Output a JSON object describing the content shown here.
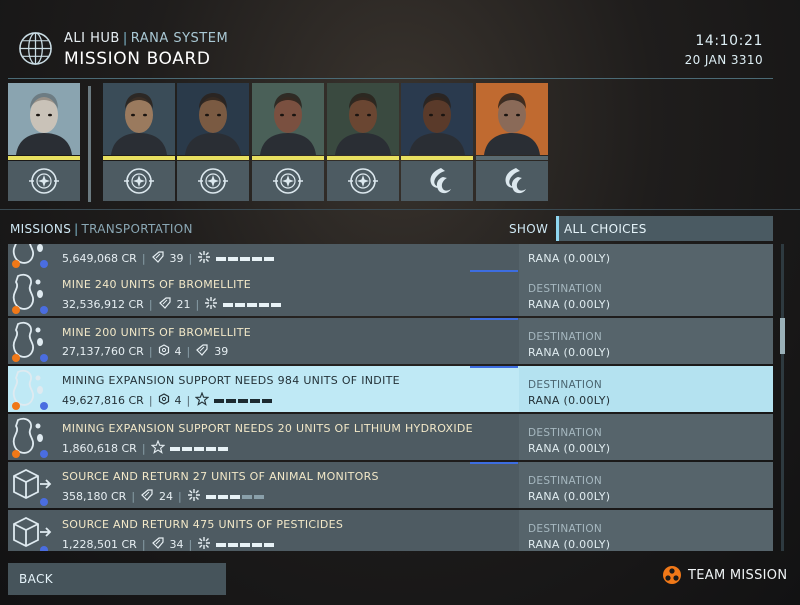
{
  "header": {
    "station": "ALI HUB",
    "system": "RANA SYSTEM",
    "title": "MISSION BOARD",
    "time": "14:10:21",
    "date": "20 JAN 3310"
  },
  "portraits": [
    {
      "faction_icon": "federation-emblem-icon",
      "bar_color": "#e8e060"
    },
    {
      "faction_icon": "federation-emblem-icon",
      "bar_color": "#e8e060"
    },
    {
      "faction_icon": "federation-emblem-icon",
      "bar_color": "#e8e060"
    },
    {
      "faction_icon": "federation-emblem-icon",
      "bar_color": "#e8e060"
    },
    {
      "faction_icon": "federation-emblem-icon",
      "bar_color": "#e8e060"
    },
    {
      "faction_icon": "alliance-emblem-icon",
      "bar_color": "#e8e060"
    },
    {
      "faction_icon": "alliance-emblem-icon",
      "bar_color": "#5a6a70"
    }
  ],
  "missions_header": {
    "label": "MISSIONS",
    "category": "TRANSPORTATION",
    "show_label": "SHOW",
    "filter_value": "ALL CHOICES"
  },
  "missions": [
    {
      "title": "",
      "reward": "5,649,068 CR",
      "rep": "39",
      "dest_label": "",
      "dest": "RANA (0.00LY)",
      "icon": "mining-icon",
      "accent": false
    },
    {
      "title": "MINE 240 UNITS OF BROMELLITE",
      "reward": "32,536,912 CR",
      "rep": "21",
      "dest_label": "DESTINATION",
      "dest": "RANA (0.00LY)",
      "icon": "mining-icon",
      "accent": true
    },
    {
      "title": "MINE 200 UNITS OF BROMELLITE",
      "reward": "27,137,760 CR",
      "mat": "4",
      "rep": "39",
      "dest_label": "DESTINATION",
      "dest": "RANA (0.00LY)",
      "icon": "mining-icon",
      "accent": true
    },
    {
      "title": "MINING EXPANSION SUPPORT NEEDS 984 UNITS OF INDITE",
      "reward": "49,627,816 CR",
      "mat": "4",
      "dest_label": "DESTINATION",
      "dest": "RANA (0.00LY)",
      "icon": "mining-icon",
      "accent": true,
      "selected": true
    },
    {
      "title": "MINING EXPANSION SUPPORT NEEDS 20 UNITS OF LITHIUM HYDROXIDE",
      "reward": "1,860,618 CR",
      "dest_label": "DESTINATION",
      "dest": "RANA (0.00LY)",
      "icon": "mining-icon",
      "accent": false
    },
    {
      "title": "SOURCE AND RETURN 27 UNITS OF ANIMAL MONITORS",
      "reward": "358,180 CR",
      "rep": "24",
      "dest_label": "DESTINATION",
      "dest": "RANA (0.00LY)",
      "icon": "cargo-crate-icon",
      "accent": true
    },
    {
      "title": "SOURCE AND RETURN 475 UNITS OF PESTICIDES",
      "reward": "1,228,501 CR",
      "rep": "34",
      "dest_label": "DESTINATION",
      "dest": "RANA (0.00LY)",
      "icon": "cargo-crate-icon",
      "accent": false
    }
  ],
  "footer": {
    "back_label": "BACK",
    "team_label": "TEAM MISSION",
    "team_color": "#f07818"
  }
}
